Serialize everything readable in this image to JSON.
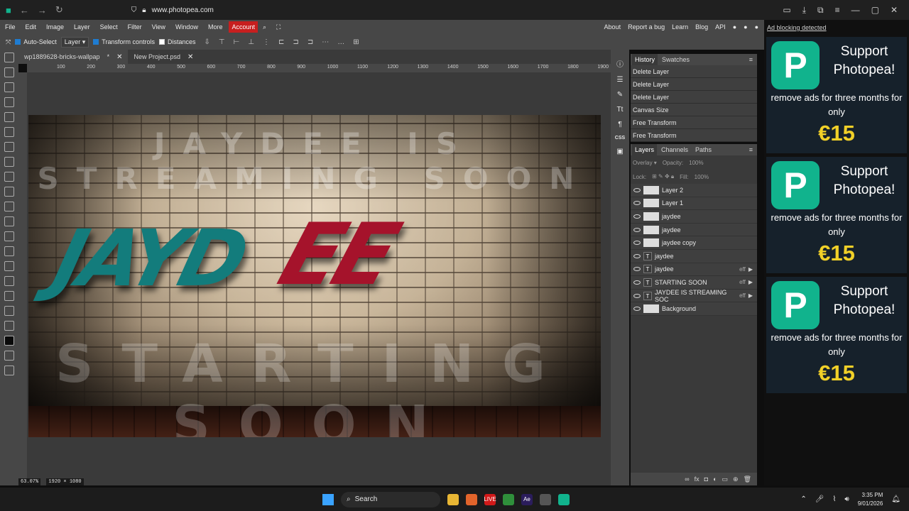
{
  "browser": {
    "url": "www.photopea.com"
  },
  "menu": {
    "items": [
      "File",
      "Edit",
      "Image",
      "Layer",
      "Select",
      "Filter",
      "View",
      "Window",
      "More"
    ],
    "account": "Account",
    "right_links": [
      "About",
      "Report a bug",
      "Learn",
      "Blog",
      "API"
    ]
  },
  "options": {
    "auto_select": "Auto-Select",
    "layer_select": "Layer",
    "transform_controls": "Transform controls",
    "distances": "Distances"
  },
  "tabs": [
    {
      "label": "wp1889628-bricks-wallpap",
      "dirty": "*"
    },
    {
      "label": "New Project.psd",
      "dirty": ""
    }
  ],
  "ruler": {
    "ticks": [
      "100",
      "200",
      "300",
      "400",
      "500",
      "600",
      "700",
      "800",
      "900",
      "1000",
      "1100",
      "1200",
      "1300",
      "1400",
      "1500",
      "1600",
      "1700",
      "1800",
      "1900"
    ]
  },
  "canvas": {
    "top_text": "JAYDEE IS STREAMING SOON",
    "bottom_text": "STARTING SOON",
    "graffiti_left": "JAYD",
    "graffiti_right": "EE"
  },
  "status": {
    "zoom": "63.07%",
    "doc_size": "1920 × 1080"
  },
  "history": {
    "tabs": [
      "History",
      "Swatches"
    ],
    "items": [
      "Delete Layer",
      "Delete Layer",
      "Delete Layer",
      "Canvas Size",
      "Free Transform",
      "Free Transform"
    ]
  },
  "layers_panel": {
    "tabs": [
      "Layers",
      "Channels",
      "Paths"
    ],
    "blend_mode": "Overlay",
    "opacity_label": "Opacity:",
    "opacity_value": "100%",
    "lock_label": "Lock:",
    "fill_label": "Fill:",
    "fill_value": "100%",
    "layers": [
      {
        "name": "Layer 2",
        "type": "image",
        "eff": ""
      },
      {
        "name": "Layer 1",
        "type": "image",
        "eff": ""
      },
      {
        "name": "jaydee",
        "type": "image",
        "eff": ""
      },
      {
        "name": "jaydee",
        "type": "image",
        "eff": ""
      },
      {
        "name": "jaydee copy",
        "type": "image",
        "eff": ""
      },
      {
        "name": "jaydee",
        "type": "text",
        "eff": ""
      },
      {
        "name": "jaydee",
        "type": "text",
        "eff": "eff"
      },
      {
        "name": "STARTING SOON",
        "type": "text",
        "eff": "eff"
      },
      {
        "name": "JAYDEE IS STREAMING SOC",
        "type": "text",
        "eff": "eff"
      },
      {
        "name": "Background",
        "type": "image",
        "eff": ""
      }
    ]
  },
  "ads": {
    "header": "Ad blocking detected",
    "title": "Support Photopea!",
    "subtitle": "remove ads for three months for only",
    "price": "€15"
  },
  "taskbar": {
    "search": "Search",
    "time": "3:35 PM",
    "date": "9/01/2026",
    "live_label": "LIVE",
    "ae_label": "Ae"
  },
  "colors": {
    "accent_account": "#c71f1f",
    "ad_price": "#f1d028",
    "photopea_green": "#11b38d"
  }
}
